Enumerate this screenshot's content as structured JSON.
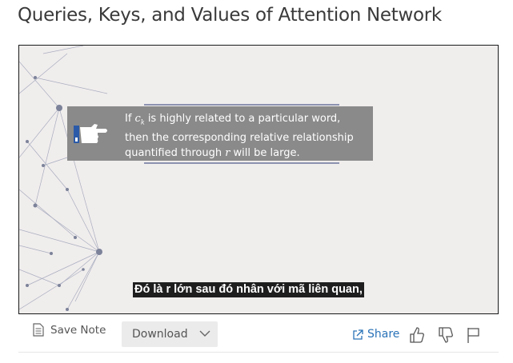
{
  "page": {
    "title": "Queries, Keys, and Values of Attention Network"
  },
  "slide": {
    "callout_line1_pre": "If ",
    "callout_line1_var": "c",
    "callout_line1_sub": "k",
    "callout_line1_post": " is highly related to a particular word,",
    "callout_line2": "then the corresponding relative relationship",
    "callout_line3_pre": "quantified through ",
    "callout_line3_var": "r",
    "callout_line3_post": " will be large.",
    "hand_icon": "pointing-hand-icon"
  },
  "subtitle": {
    "text": "Đó là r lớn sau đó nhân với mã liên quan,"
  },
  "toolbar": {
    "save_note_label": "Save Note",
    "download_label": "Download",
    "share_label": "Share"
  },
  "colors": {
    "accent": "#2a73b8",
    "callout_bg": "#8a8a8a",
    "slide_bg": "#f0eded"
  }
}
